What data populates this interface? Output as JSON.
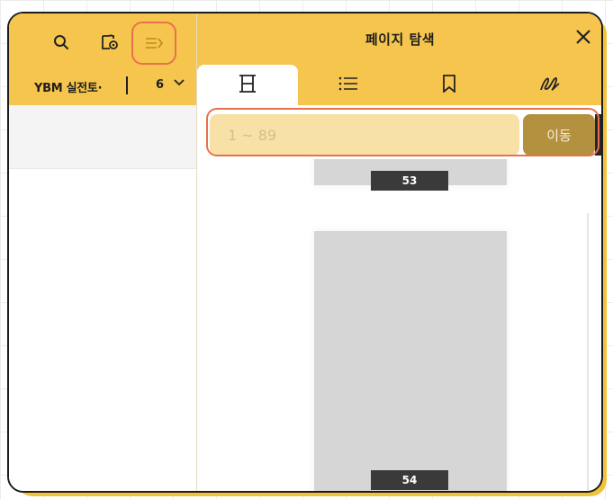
{
  "toolbar": {
    "book_title": "YBM 실전토·",
    "page_value": "6"
  },
  "panel": {
    "title": "페이지 탐색"
  },
  "goto": {
    "placeholder": "1 ~ 89",
    "button_label": "이동"
  },
  "thumbnails": [
    {
      "page_label": "53"
    },
    {
      "page_label": "54"
    }
  ],
  "colors": {
    "header": "#f6c54d",
    "accent_button": "#b3913f",
    "highlight": "#e9704f",
    "input_bg": "#f7e1a7"
  },
  "icons": [
    "search-icon",
    "settings-icon",
    "collapse-panel-icon",
    "close-icon",
    "outline-icon",
    "list-icon",
    "bookmark-icon",
    "handwriting-icon",
    "chevron-down-icon"
  ]
}
